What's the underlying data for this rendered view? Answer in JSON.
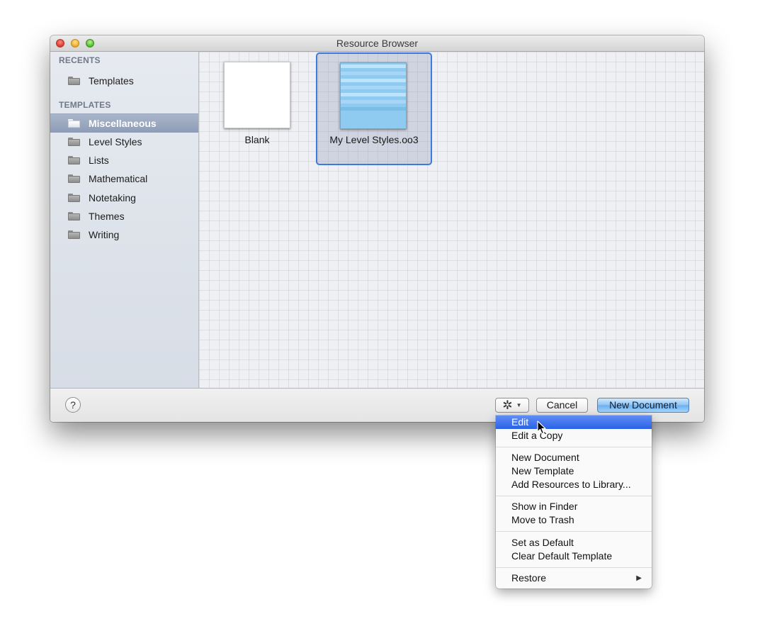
{
  "window": {
    "title": "Resource Browser"
  },
  "sidebar": {
    "recents_header": "RECENTS",
    "recents": [
      {
        "label": "Templates"
      }
    ],
    "templates_header": "TEMPLATES",
    "templates": [
      {
        "label": "Miscellaneous",
        "selected": true
      },
      {
        "label": "Level Styles"
      },
      {
        "label": "Lists"
      },
      {
        "label": "Mathematical"
      },
      {
        "label": "Notetaking"
      },
      {
        "label": "Themes"
      },
      {
        "label": "Writing"
      }
    ]
  },
  "content": {
    "tiles": [
      {
        "label": "Blank"
      },
      {
        "label": "My Level Styles.oo3",
        "selected": true
      }
    ]
  },
  "bottombar": {
    "help_label": "?",
    "gear_icon": "gear-icon",
    "cancel_label": "Cancel",
    "new_document_label": "New Document"
  },
  "menu": {
    "groups": [
      [
        {
          "label": "Edit",
          "highlighted": true
        },
        {
          "label": "Edit a Copy"
        }
      ],
      [
        {
          "label": "New Document"
        },
        {
          "label": "New Template"
        },
        {
          "label": "Add Resources to Library..."
        }
      ],
      [
        {
          "label": "Show in Finder"
        },
        {
          "label": "Move to Trash"
        }
      ],
      [
        {
          "label": "Set as Default"
        },
        {
          "label": "Clear Default Template"
        }
      ],
      [
        {
          "label": "Restore",
          "submenu": true
        }
      ]
    ]
  },
  "colors": {
    "selection_blue": "#3d7ae0",
    "menu_highlight": "#2a62e8",
    "sidebar_selected": "#8d9cb6"
  }
}
